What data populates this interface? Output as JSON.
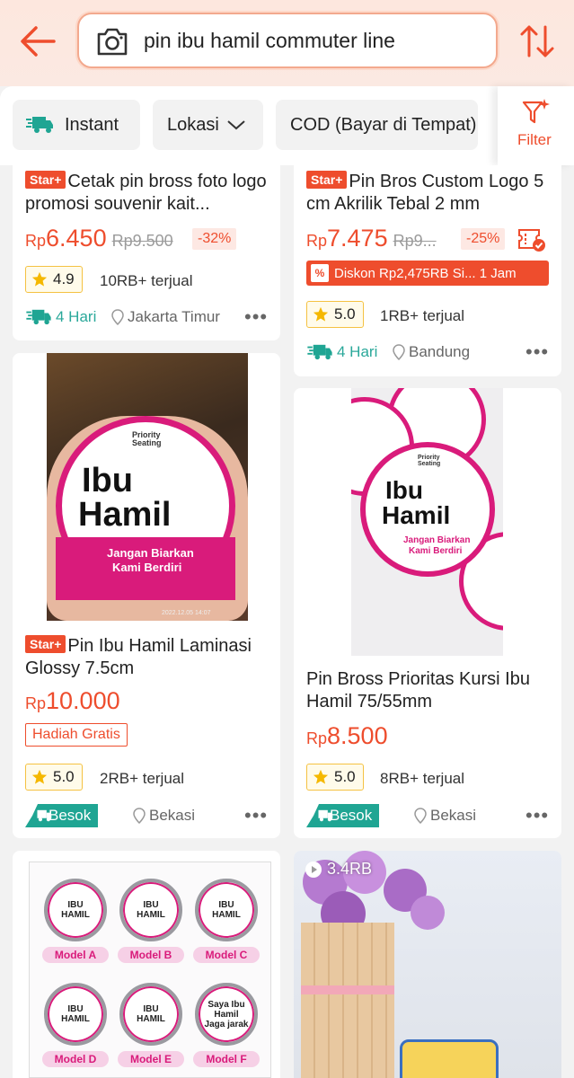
{
  "search": {
    "query": "pin ibu hamil commuter line"
  },
  "filters": {
    "instant": "Instant",
    "lokasi": "Lokasi",
    "cod": "COD (Bayar di Tempat)",
    "filter": "Filter"
  },
  "products": [
    {
      "badge": "Star+",
      "title": "Cetak pin bross foto logo promosi souvenir kait...",
      "currency": "Rp",
      "price": "6.450",
      "old_price": "Rp9.500",
      "discount": "-32%",
      "rating": "4.9",
      "sold": "10RB+ terjual",
      "shipping": "4 Hari",
      "location": "Jakarta Timur"
    },
    {
      "badge": "Star+",
      "title": "Pin Bros Custom Logo 5 cm Akrilik Tebal 2 mm",
      "currency": "Rp",
      "price": "7.475",
      "old_price": "Rp9...",
      "discount": "-25%",
      "promo": "Diskon Rp2,475RB Si... 1 Jam",
      "rating": "5.0",
      "sold": "1RB+ terjual",
      "shipping": "4 Hari",
      "location": "Bandung"
    },
    {
      "badge": "Star+",
      "title": "Pin Ibu Hamil Laminasi Glossy 7.5cm",
      "currency": "Rp",
      "price": "10.000",
      "gift_tag": "Hadiah Gratis",
      "rating": "5.0",
      "sold": "2RB+ terjual",
      "shipping": "Besok",
      "location": "Bekasi",
      "image_text": {
        "top": "Priority Seating",
        "main1": "Ibu",
        "main2": "Hamil",
        "bottom1": "Jangan Biarkan",
        "bottom2": "Kami Berdiri",
        "date": "2022.12.05 14:07"
      }
    },
    {
      "title": "Pin Bross Prioritas Kursi Ibu Hamil 75/55mm",
      "currency": "Rp",
      "price": "8.500",
      "rating": "5.0",
      "sold": "8RB+ terjual",
      "shipping": "Besok",
      "location": "Bekasi",
      "image_text": {
        "top": "Priority Seating",
        "main1": "Ibu",
        "main2": "Hamil",
        "bottom1": "Jangan Biarkan",
        "bottom2": "Kami Berdiri"
      }
    },
    {
      "image_models": [
        "Model A",
        "Model B",
        "Model C",
        "Model D",
        "Model E",
        "Model F"
      ],
      "image_labels": [
        "IBU HAMIL",
        "IBU HAMIL",
        "IBU HAMIL",
        "IBU HAMIL",
        "IBU HAMIL",
        "Saya Ibu Hamil Jaga jarak"
      ]
    },
    {
      "video_views": "3.4RB"
    }
  ],
  "colors": {
    "accent": "#ee4d2d",
    "teal": "#1fa593",
    "pink": "#d91b7b"
  }
}
